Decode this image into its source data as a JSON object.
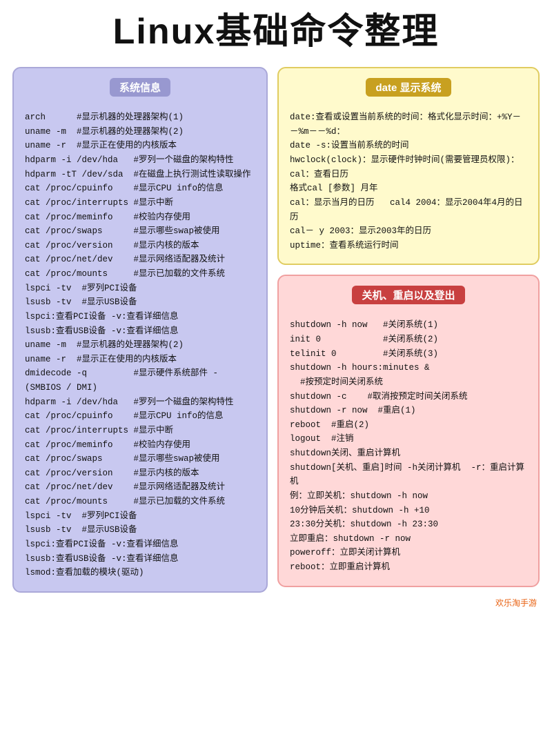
{
  "title": "Linux基础命令整理",
  "sysinfo": {
    "header": "系统信息",
    "content": "arch      #显示机器的处理器架构(1)\nuname -m  #显示机器的处理器架构(2)\nuname -r  #显示正在使用的内核版本\nhdparm -i /dev/hda   #罗列一个磁盘的架构特性\nhdparm -tT /dev/sda  #在磁盘上执行测试性读取操作\ncat /proc/cpuinfo    #显示CPU info的信息\ncat /proc/interrupts #显示中断\ncat /proc/meminfo    #校验内存使用\ncat /proc/swaps      #显示哪些swap被使用\ncat /proc/version    #显示内核的版本\ncat /proc/net/dev    #显示网络适配器及统计\ncat /proc/mounts     #显示已加载的文件系统\nlspci -tv  #罗列PCI设备\nlsusb -tv  #显示USB设备\nlspci:查看PCI设备 -v:查看详细信息\nlsusb:查看USB设备 -v:查看详细信息\nuname -m  #显示机器的处理器架构(2)\nuname -r  #显示正在使用的内核版本\ndmidecode -q         #显示硬件系统部件 -\n(SMBIOS / DMI)\nhdparm -i /dev/hda   #罗列一个磁盘的架构特性\ncat /proc/cpuinfo    #显示CPU info的信息\ncat /proc/interrupts #显示中断\ncat /proc/meminfo    #校验内存使用\ncat /proc/swaps      #显示哪些swap被使用\ncat /proc/version    #显示内核的版本\ncat /proc/net/dev    #显示网络适配器及统计\ncat /proc/mounts     #显示已加载的文件系统\nlspci -tv  #罗列PCI设备\nlsusb -tv  #显示USB设备\nlspci:查看PCI设备 -v:查看详细信息\nlsusb:查看USB设备 -v:查看详细信息\nlsmod:查看加载的模块(驱动)"
  },
  "date": {
    "header": "date 显示系统",
    "content": "date:查看或设置当前系统的时间：格式化显示时间：+%Y－－%m－－%d：\ndate -s:设置当前系统的时间\nhwclock(clock)：显示硬件时钟时间(需要管理员权限)：\ncal：查看日历\n格式cal [参数] 月年\ncal：显示当月的日历   cal4 2004：显示2004年4月的日历\ncal－ y 2003：显示2003年的日历\nuptime：查看系统运行时间"
  },
  "shutdown": {
    "header": "关机、重启以及登出",
    "content": "shutdown -h now   #关闭系统(1)\ninit 0            #关闭系统(2)\ntelinit 0         #关闭系统(3)\nshutdown -h hours:minutes &\n  #按预定时间关闭系统\nshutdown -c    #取消按预定时间关闭系统\nshutdown -r now  #重启(1)\nreboot  #重启(2)\nlogout  #注销\nshutdown关闭、重启计算机\nshutdown[关机、重启]时间 -h关闭计算机  -r：重启计算机\n例：立即关机：shutdown -h now\n10分钟后关机：shutdown -h +10\n23:30分关机：shutdown -h 23:30\n立即重启：shutdown -r now\npoweroff：立即关闭计算机\nreboot：立即重启计算机"
  },
  "watermark": "欢乐淘手游"
}
